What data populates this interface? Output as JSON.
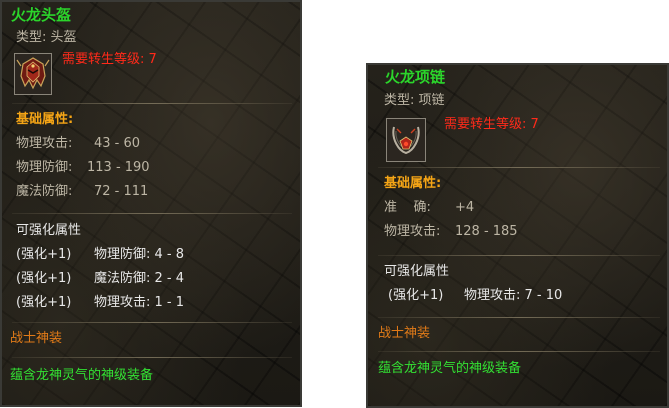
{
  "helmet": {
    "name": "火龙头盔",
    "type_line": "类型: 头盔",
    "requirement": "需要转生等级: 7",
    "icon": "dragon-helmet-icon",
    "base_header": "基础属性:",
    "base_stats": [
      {
        "label": "物理攻击:",
        "value": "43 - 60"
      },
      {
        "label": "物理防御:",
        "value": "113 - 190"
      },
      {
        "label": "魔法防御:",
        "value": "72 - 111"
      }
    ],
    "upgrade_header": "可强化属性",
    "upgrades": [
      {
        "level": "(强化+1)",
        "stat": "物理防御: 4 - 8"
      },
      {
        "level": "(强化+1)",
        "stat": "魔法防御: 2 - 4"
      },
      {
        "level": "(强化+1)",
        "stat": "物理攻击: 1 - 1"
      }
    ],
    "class_line": "战士神装",
    "description": "蕴含龙神灵气的神级装备"
  },
  "necklace": {
    "name": "火龙项链",
    "type_line": "类型: 项链",
    "requirement": "需要转生等级: 7",
    "icon": "dragon-necklace-icon",
    "base_header": "基础属性:",
    "base_stats": [
      {
        "label": "准    确:",
        "value": "+4"
      },
      {
        "label": "物理攻击:",
        "value": "128 - 185"
      }
    ],
    "upgrade_header": "可强化属性",
    "upgrades": [
      {
        "level": "(强化+1)",
        "stat": "物理攻击: 7 - 10"
      }
    ],
    "class_line": "战士神装",
    "description": "蕴含龙神灵气的神级装备"
  },
  "colors": {
    "item_name": "#2bd52b",
    "requirement": "#ff2a1a",
    "section_header": "#f5a516",
    "class_line": "#e07a18",
    "description": "#33e033",
    "text_grey": "#bdb6a5"
  }
}
